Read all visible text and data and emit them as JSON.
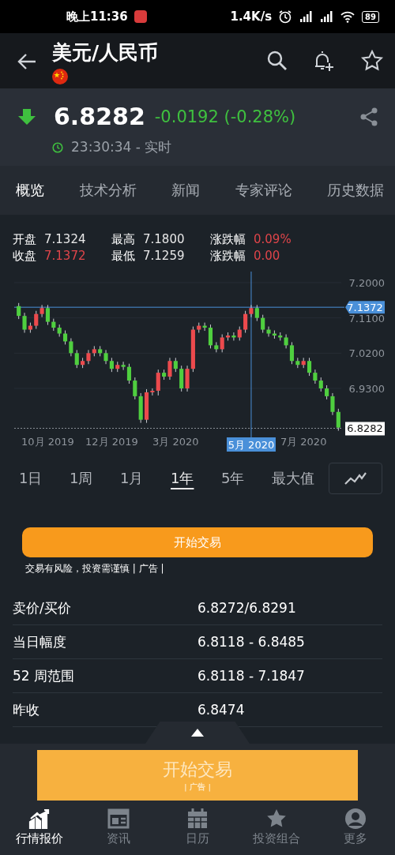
{
  "status_bar": {
    "time": "晚上11:36",
    "speed": "1.4K/s",
    "battery": "89"
  },
  "app_bar": {
    "title": "美元/人民币"
  },
  "quote": {
    "price": "6.8282",
    "change": "-0.0192 (-0.28%)",
    "down": true,
    "time": "23:30:34 - 实时"
  },
  "tabs": [
    {
      "label": "概览",
      "selected": true
    },
    {
      "label": "技术分析",
      "selected": false
    },
    {
      "label": "新闻",
      "selected": false
    },
    {
      "label": "专家评论",
      "selected": false
    },
    {
      "label": "历史数据",
      "selected": false
    }
  ],
  "ohlc": [
    {
      "label": "开盘",
      "value": "7.1324",
      "kind": "plain"
    },
    {
      "label": "最高",
      "value": "7.1800",
      "kind": "plain"
    },
    {
      "label": "涨跌幅",
      "value": "0.09%",
      "kind": "rise"
    },
    {
      "label": "收盘",
      "value": "7.1372",
      "kind": "rise"
    },
    {
      "label": "最低",
      "value": "7.1259",
      "kind": "plain"
    },
    {
      "label": "涨跌幅",
      "value": "0.00",
      "kind": "rise"
    }
  ],
  "chart": {
    "crosshair_date": "5月 2020",
    "chart_data": {
      "type": "candlestick",
      "grid": true,
      "ref_lines": [
        {
          "axis": "y",
          "value": 7.1372,
          "label": "7.1372",
          "color": "#4a90d9"
        },
        {
          "axis": "y",
          "value": 6.8282,
          "label": "6.8282",
          "color": "#8a9097"
        }
      ],
      "categories": [
        null,
        null,
        null,
        null,
        null,
        "10月 2019",
        null,
        null,
        null,
        null,
        null,
        null,
        null,
        null,
        null,
        null,
        "12月 2019",
        null,
        null,
        null,
        null,
        null,
        null,
        null,
        null,
        null,
        null,
        "3月 2020",
        null,
        null,
        null,
        null,
        null,
        null,
        null,
        null,
        null,
        null,
        null,
        null,
        null,
        null,
        null,
        null,
        null,
        null,
        null,
        null,
        null,
        "7月 2020",
        null,
        null,
        null,
        null,
        null,
        null
      ],
      "ylim": [
        6.805,
        7.2
      ],
      "ohlc": [
        [
          7.14,
          7.148,
          7.107,
          7.115
        ],
        [
          7.115,
          7.123,
          7.072,
          7.08
        ],
        [
          7.08,
          7.098,
          7.072,
          7.09
        ],
        [
          7.09,
          7.128,
          7.082,
          7.12
        ],
        [
          7.12,
          7.143,
          7.112,
          7.135
        ],
        [
          7.135,
          7.143,
          7.092,
          7.1
        ],
        [
          7.1,
          7.108,
          7.077,
          7.085
        ],
        [
          7.085,
          7.093,
          7.062,
          7.07
        ],
        [
          7.07,
          7.078,
          7.042,
          7.05
        ],
        [
          7.05,
          7.058,
          7.012,
          7.02
        ],
        [
          7.02,
          7.028,
          6.982,
          6.99
        ],
        [
          6.99,
          7.008,
          6.982,
          7.0
        ],
        [
          7.0,
          7.028,
          6.992,
          7.02
        ],
        [
          7.02,
          7.038,
          7.012,
          7.03
        ],
        [
          7.03,
          7.038,
          7.012,
          7.02
        ],
        [
          7.02,
          7.028,
          6.992,
          7.0
        ],
        [
          7.0,
          7.008,
          6.972,
          6.98
        ],
        [
          6.98,
          6.998,
          6.972,
          6.99
        ],
        [
          6.99,
          6.998,
          6.977,
          6.985
        ],
        [
          6.985,
          6.993,
          6.942,
          6.95
        ],
        [
          6.95,
          6.958,
          6.902,
          6.91
        ],
        [
          6.91,
          6.918,
          6.842,
          6.85
        ],
        [
          6.85,
          6.928,
          6.842,
          6.92
        ],
        [
          6.92,
          6.93,
          6.912,
          6.924
        ],
        [
          6.924,
          6.978,
          6.912,
          6.97
        ],
        [
          6.97,
          6.978,
          6.952,
          6.96
        ],
        [
          6.96,
          7.008,
          6.952,
          7.0
        ],
        [
          7.0,
          7.008,
          6.972,
          6.98
        ],
        [
          6.98,
          6.988,
          6.922,
          6.93
        ],
        [
          6.93,
          6.988,
          6.922,
          6.98
        ],
        [
          6.98,
          7.088,
          6.972,
          7.08
        ],
        [
          7.08,
          7.098,
          7.072,
          7.09
        ],
        [
          7.09,
          7.098,
          7.077,
          7.085
        ],
        [
          7.085,
          7.093,
          7.032,
          7.04
        ],
        [
          7.04,
          7.048,
          7.022,
          7.03
        ],
        [
          7.03,
          7.068,
          7.022,
          7.06
        ],
        [
          7.06,
          7.073,
          7.052,
          7.065
        ],
        [
          7.065,
          7.073,
          7.052,
          7.06
        ],
        [
          7.06,
          7.088,
          7.052,
          7.08
        ],
        [
          7.08,
          7.128,
          7.072,
          7.12
        ],
        [
          7.12,
          7.143,
          7.112,
          7.135
        ],
        [
          7.135,
          7.143,
          7.102,
          7.11
        ],
        [
          7.11,
          7.118,
          7.072,
          7.08
        ],
        [
          7.08,
          7.088,
          7.062,
          7.07
        ],
        [
          7.07,
          7.078,
          7.057,
          7.065
        ],
        [
          7.065,
          7.073,
          7.052,
          7.06
        ],
        [
          7.06,
          7.068,
          7.032,
          7.04
        ],
        [
          7.04,
          7.048,
          6.992,
          7.0
        ],
        [
          7.0,
          7.008,
          6.982,
          6.99
        ],
        [
          6.99,
          7.008,
          6.982,
          7.0
        ],
        [
          7.0,
          7.008,
          6.962,
          6.97
        ],
        [
          6.97,
          6.978,
          6.942,
          6.95
        ],
        [
          6.95,
          6.958,
          6.922,
          6.93
        ],
        [
          6.93,
          6.938,
          6.902,
          6.91
        ],
        [
          6.91,
          6.918,
          6.862,
          6.87
        ],
        [
          6.87,
          6.878,
          6.822,
          6.83
        ]
      ],
      "yticks": [
        {
          "value": 7.2,
          "label": "7.2000"
        },
        {
          "value": 7.11,
          "label": "7.1100"
        },
        {
          "value": 7.02,
          "label": "7.0200"
        },
        {
          "value": 6.93,
          "label": "6.9300"
        }
      ]
    }
  },
  "periods": [
    {
      "label": "1日",
      "selected": false
    },
    {
      "label": "1周",
      "selected": false
    },
    {
      "label": "1月",
      "selected": false
    },
    {
      "label": "1年",
      "selected": true
    },
    {
      "label": "5年",
      "selected": false
    },
    {
      "label": "最大值",
      "selected": false
    }
  ],
  "trade_button": "开始交易",
  "disclaimer": "交易有风险，投资需谨慎 | 广告 |",
  "stats": [
    {
      "label": "卖价/买价",
      "value": "6.8272/6.8291"
    },
    {
      "label": "当日幅度",
      "value": "6.8118 - 6.8485"
    },
    {
      "label": "52 周范围",
      "value": "6.8118 - 7.1847"
    },
    {
      "label": "昨收",
      "value": "6.8474"
    }
  ],
  "ad_banner": {
    "title": "开始交易",
    "tag": "| 广告 |"
  },
  "nav": [
    {
      "label": "行情报价",
      "selected": true
    },
    {
      "label": "资讯",
      "selected": false
    },
    {
      "label": "日历",
      "selected": false
    },
    {
      "label": "投资组合",
      "selected": false
    },
    {
      "label": "更多",
      "selected": false
    }
  ]
}
